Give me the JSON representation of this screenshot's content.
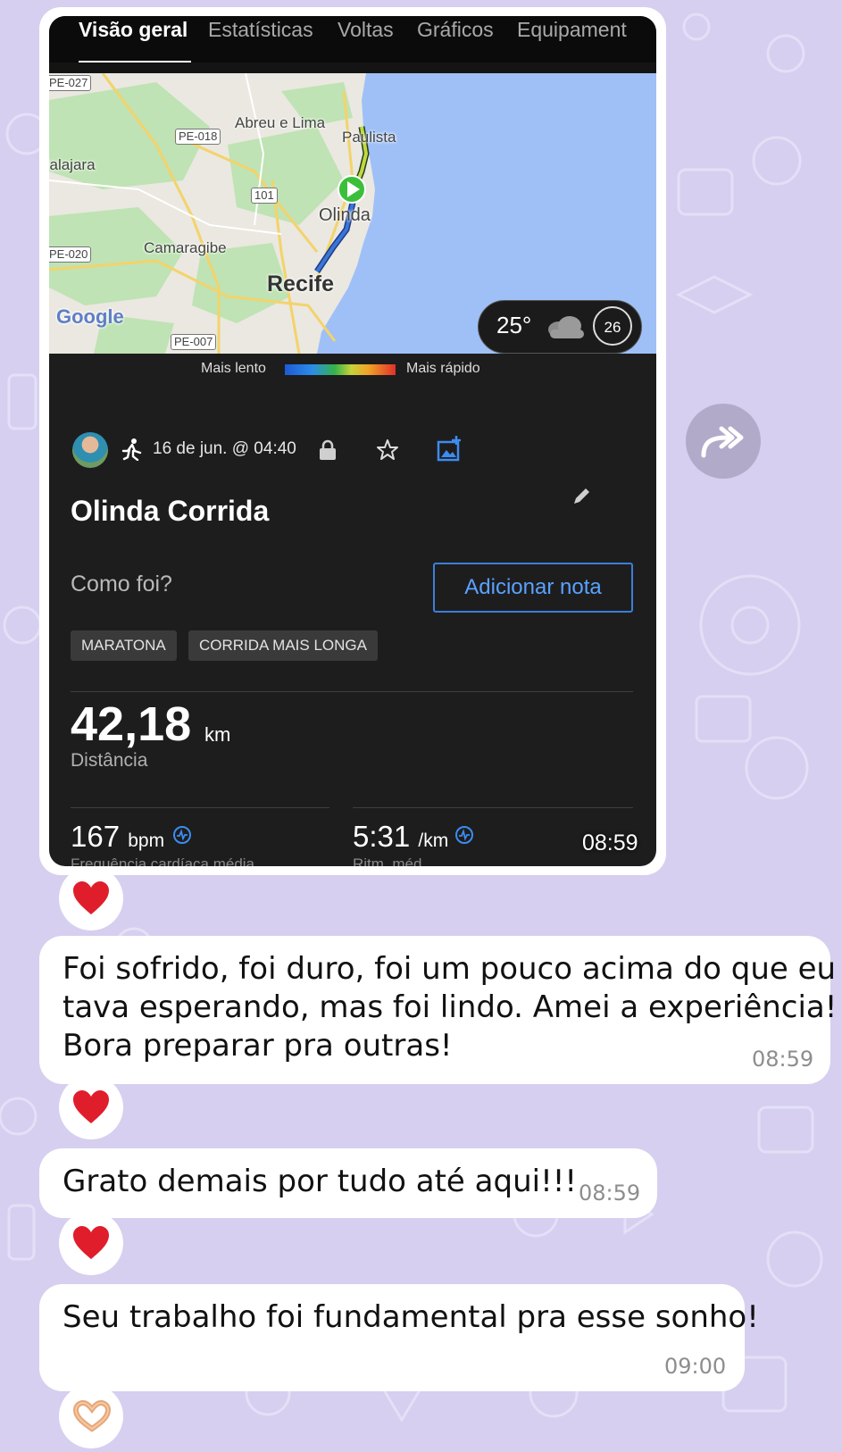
{
  "tabs": [
    "Visão geral",
    "Estatísticas",
    "Voltas",
    "Gráficos",
    "Equipament"
  ],
  "map": {
    "labels": [
      "PE-027",
      "Abreu e Lima",
      "PE-018",
      "Paulista",
      "Jalajara",
      "101",
      "Olinda",
      "PE-020",
      "Camaragibe",
      "Recife",
      "Google",
      "PE-007"
    ],
    "weather_temp": "25°",
    "weather_badge": "26"
  },
  "legend": {
    "slow": "Mais lento",
    "fast": "Mais rápido"
  },
  "activity": {
    "date": "16 de jun. @ 04:40",
    "title": "Olinda Corrida",
    "prompt": "Como foi?",
    "note_button": "Adicionar nota",
    "tags": [
      "MARATONA",
      "CORRIDA MAIS LONGA"
    ],
    "distance_value": "42,18",
    "distance_unit": "km",
    "distance_label": "Distância",
    "hr_value": "167",
    "hr_unit": "bpm",
    "hr_label": "Frequência cardíaca média",
    "pace_value": "5:31",
    "pace_unit": "/km",
    "pace_label": "Ritm. méd."
  },
  "messages": [
    {
      "time": "08:59"
    },
    {
      "lines": [
        "Foi sofrido, foi duro, foi um pouco acima do que eu",
        "tava esperando, mas foi lindo. Amei a experiência!",
        "Bora preparar pra outras!"
      ],
      "time": "08:59"
    },
    {
      "lines": [
        "Grato demais por tudo até aqui!!!"
      ],
      "time": "08:59"
    },
    {
      "lines": [
        "Seu trabalho foi fundamental pra esse sonho!"
      ],
      "time": "09:00"
    }
  ],
  "colors": {
    "wallpaper": "#d6cff0",
    "link_blue": "#5aa2ff",
    "heart": "#e01e2b",
    "route_green": "#3bbf3b"
  }
}
